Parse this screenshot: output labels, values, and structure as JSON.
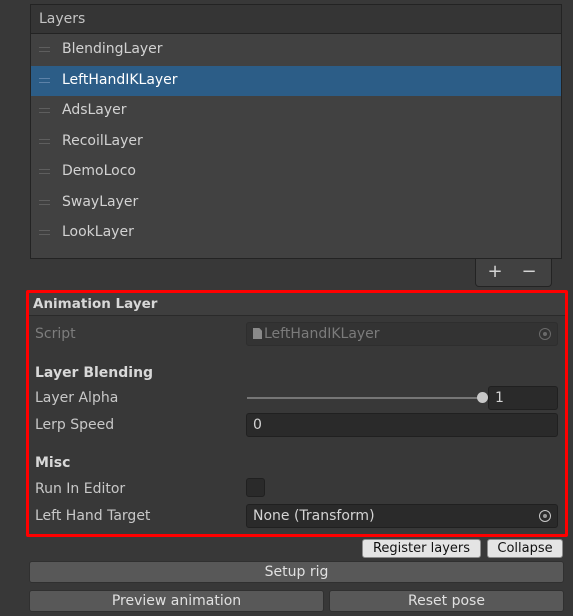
{
  "layers": {
    "header": "Layers",
    "items": [
      {
        "label": "BlendingLayer",
        "selected": false
      },
      {
        "label": "LeftHandIKLayer",
        "selected": true
      },
      {
        "label": "AdsLayer",
        "selected": false
      },
      {
        "label": "RecoilLayer",
        "selected": false
      },
      {
        "label": "DemoLoco",
        "selected": false
      },
      {
        "label": "SwayLayer",
        "selected": false
      },
      {
        "label": "LookLayer",
        "selected": false
      }
    ],
    "add_label": "+",
    "remove_label": "−"
  },
  "inspector": {
    "header": "Animation Layer",
    "script_label": "Script",
    "script_value": "LeftHandIKLayer",
    "blending_title": "Layer Blending",
    "alpha_label": "Layer Alpha",
    "alpha_value": "1",
    "alpha_fraction": 1.0,
    "lerp_label": "Lerp Speed",
    "lerp_value": "0",
    "misc_title": "Misc",
    "run_in_editor_label": "Run In Editor",
    "run_in_editor_checked": false,
    "left_hand_label": "Left Hand Target",
    "left_hand_value": "None (Transform)"
  },
  "buttons": {
    "register": "Register layers",
    "collapse": "Collapse",
    "setup_rig": "Setup rig",
    "preview": "Preview animation",
    "reset_pose": "Reset pose"
  },
  "colors": {
    "background": "#383838",
    "selection": "#2c5d87",
    "highlight_border": "#ff0000"
  }
}
